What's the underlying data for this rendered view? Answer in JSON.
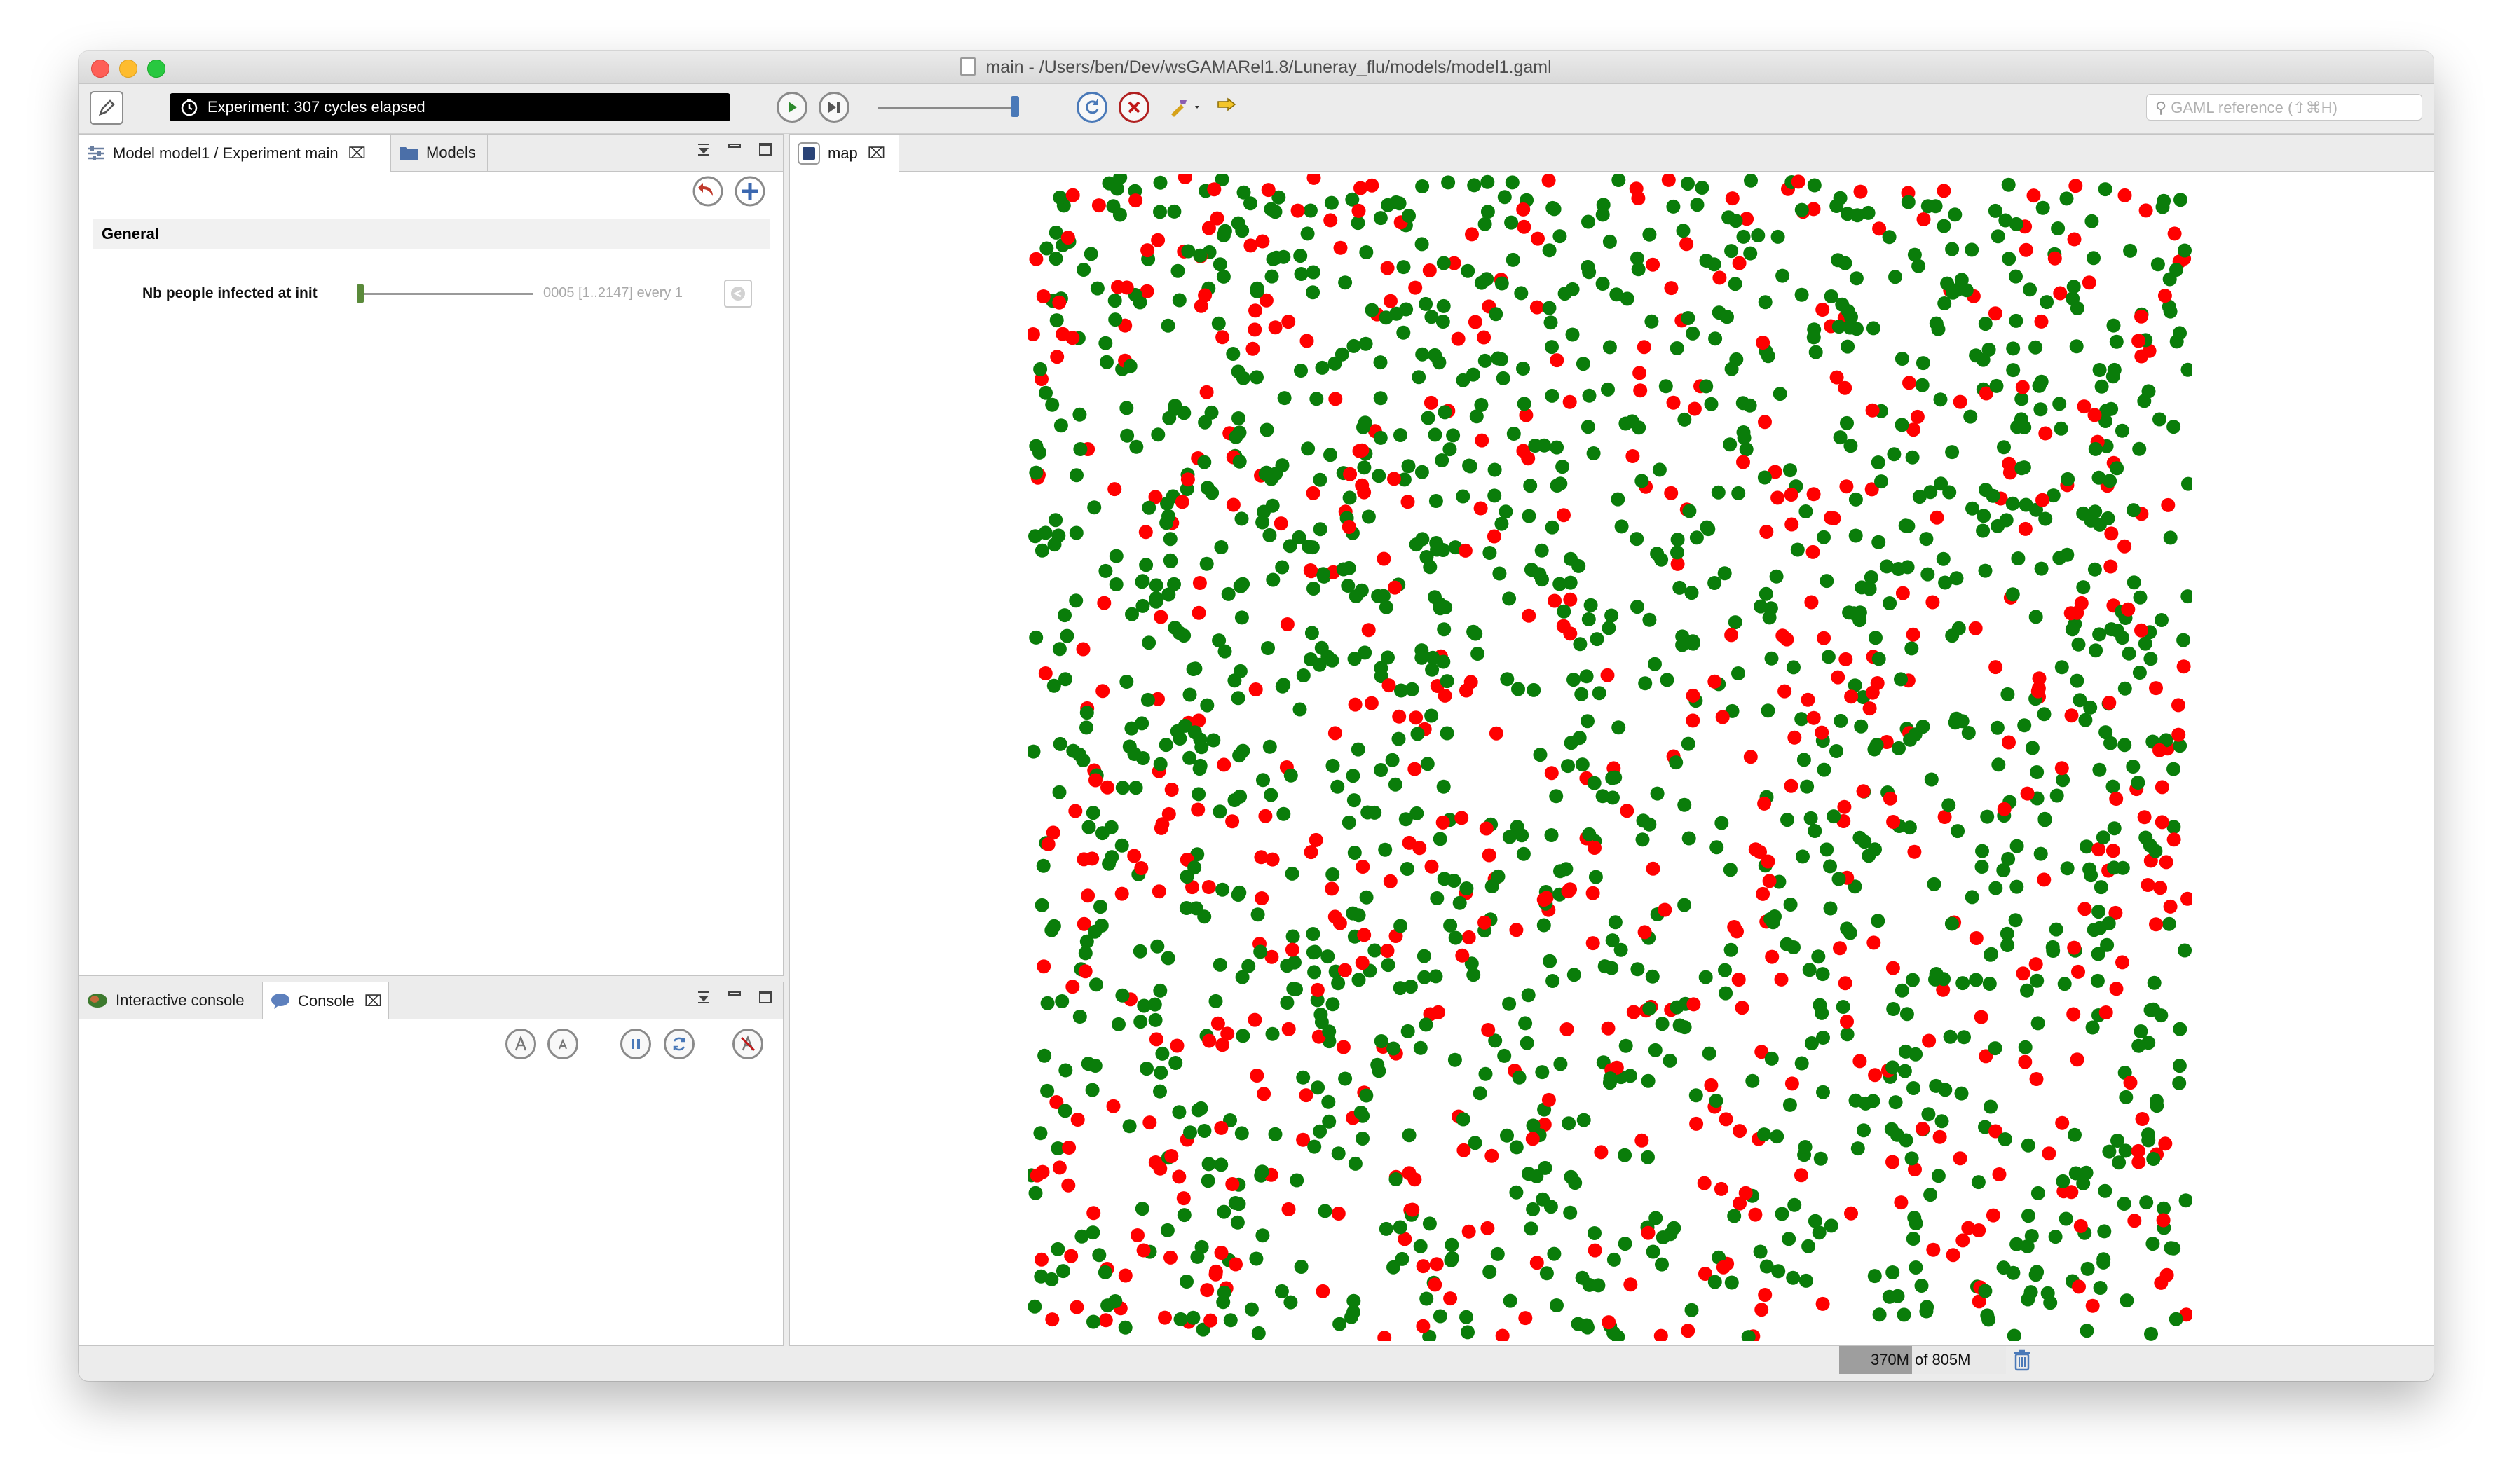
{
  "window": {
    "title": "main - /Users/ben/Dev/wsGAMARel1.8/Luneray_flu/models/model1.gaml"
  },
  "toolbar": {
    "status": "Experiment: 307 cycles elapsed",
    "search_placeholder": "GAML reference (⇧⌘H)",
    "icons": [
      "edit-icon",
      "clock-icon",
      "play-icon",
      "step-icon",
      "reload-icon",
      "close-experiment-icon",
      "build-icon",
      "pointer-icon"
    ]
  },
  "parameters_panel": {
    "tabs": [
      {
        "label": "Model model1 / Experiment main",
        "icon": "parameters-icon"
      },
      {
        "label": "Models",
        "icon": "folder-icon"
      }
    ],
    "section": "General",
    "parameter": {
      "label": "Nb people infected at init",
      "value_text": "0005 [1..2147] every 1",
      "value": 5,
      "min": 1,
      "max": 2147
    }
  },
  "console_panel": {
    "tabs": [
      {
        "label": "Interactive console",
        "icon": "brain-icon"
      },
      {
        "label": "Console",
        "icon": "speech-icon"
      }
    ]
  },
  "map_panel": {
    "tab_label": "map",
    "colors": {
      "healthy": "#0a7d0a",
      "infected": "#ff0000"
    }
  },
  "statusbar": {
    "memory_used": "370M",
    "memory_total": "of 805M"
  }
}
